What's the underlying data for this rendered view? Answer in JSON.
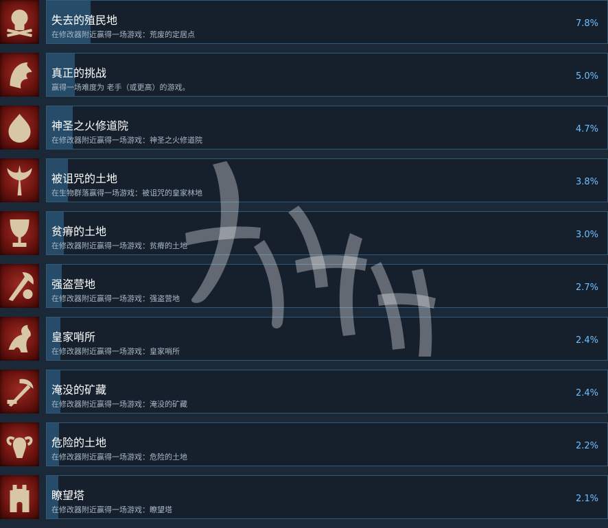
{
  "achievements": [
    {
      "title": "失去的殖民地",
      "desc": "在修改器附近赢得一场游戏：荒废的定居点",
      "percent": "7.8%",
      "fill": 0.078,
      "icon": "skull-icon"
    },
    {
      "title": "真正的挑战",
      "desc": "赢得一场难度为 老手（或更高）的游戏。",
      "percent": "5.0%",
      "fill": 0.05,
      "icon": "eagle-icon"
    },
    {
      "title": "神圣之火修道院",
      "desc": "在修改器附近赢得一场游戏：神圣之火修道院",
      "percent": "4.7%",
      "fill": 0.047,
      "icon": "sacred-flame-icon"
    },
    {
      "title": "被诅咒的土地",
      "desc": "在生物群落赢得一场游戏：被诅咒的皇家林地",
      "percent": "3.8%",
      "fill": 0.038,
      "icon": "cursed-tree-icon"
    },
    {
      "title": "贫瘠的土地",
      "desc": "在修改器附近赢得一场游戏：贫瘠的土地",
      "percent": "3.0%",
      "fill": 0.03,
      "icon": "chalice-icon"
    },
    {
      "title": "强盗营地",
      "desc": "在修改器附近赢得一场游戏：强盗营地",
      "percent": "2.7%",
      "fill": 0.027,
      "icon": "axe-skull-icon"
    },
    {
      "title": "皇家哨所",
      "desc": "在修改器附近赢得一场游戏：皇家哨所",
      "percent": "2.4%",
      "fill": 0.024,
      "icon": "griffin-icon"
    },
    {
      "title": "淹没的矿藏",
      "desc": "在修改器附近赢得一场游戏：淹没的矿藏",
      "percent": "2.4%",
      "fill": 0.024,
      "icon": "pickaxe-icon"
    },
    {
      "title": "危险的土地",
      "desc": "在修改器附近赢得一场游戏：危险的土地",
      "percent": "2.2%",
      "fill": 0.022,
      "icon": "ram-skull-icon"
    },
    {
      "title": "瞭望塔",
      "desc": "在修改器附近赢得一场游戏：瞭望塔",
      "percent": "2.1%",
      "fill": 0.021,
      "icon": "tower-icon"
    }
  ],
  "colors": {
    "background": "#1b2838",
    "panel_border": "#2f5b77",
    "progress_fill": "#264c6a",
    "percent_text": "#6fc0ff",
    "badge_red": "#9c2a23",
    "badge_emblem": "#d8c7a6"
  }
}
